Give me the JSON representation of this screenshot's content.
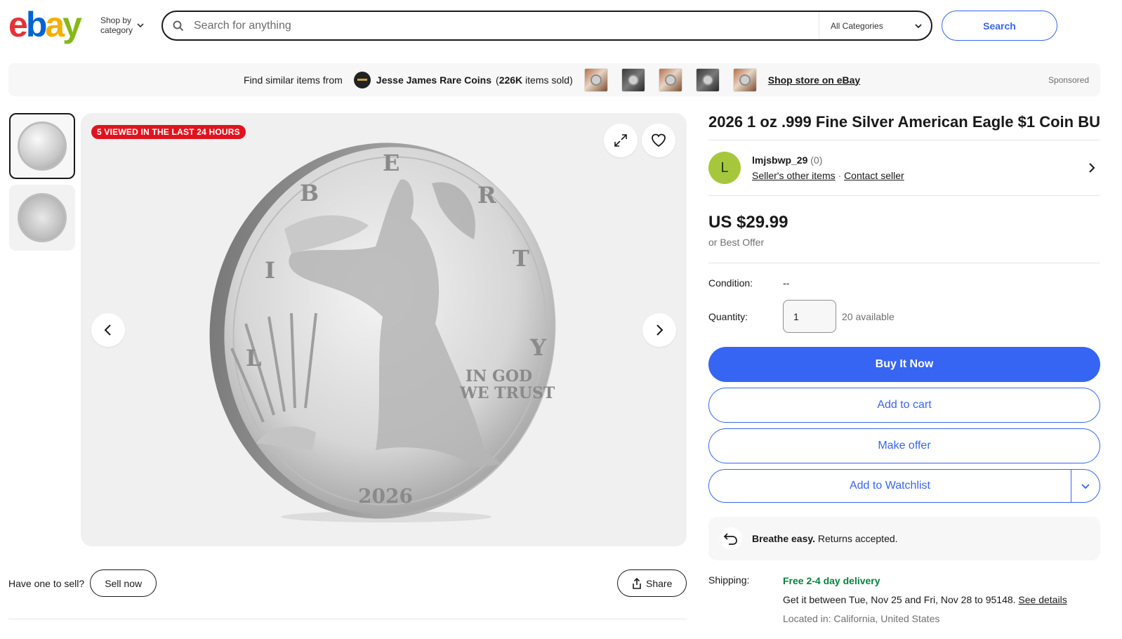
{
  "header": {
    "logo": {
      "e": "e",
      "b": "b",
      "a": "a",
      "y": "y"
    },
    "shop_by_line1": "Shop by",
    "shop_by_line2": "category",
    "search_placeholder": "Search for anything",
    "category_select": "All Categories",
    "search_button": "Search"
  },
  "store_bar": {
    "find_text": "Find similar items from",
    "store_name": "Jesse James Rare Coins",
    "items_sold_open": "(",
    "items_sold_count": "226K",
    "items_sold_rest": " items sold)",
    "shop_link": "Shop store on eBay",
    "sponsored": "Sponsored"
  },
  "gallery": {
    "badge": "5 VIEWED IN THE LAST 24 HOURS",
    "coin_text_year": "2026",
    "coin_text_motto_1": "IN GOD",
    "coin_text_motto_2": "WE TRUST",
    "coin_text_liberty": [
      "L",
      "I",
      "B",
      "E",
      "R",
      "T",
      "Y"
    ]
  },
  "sell": {
    "prompt": "Have one to sell?",
    "sell_button": "Sell now",
    "share_button": "Share"
  },
  "listing": {
    "title": "2026 1 oz .999 Fine Silver American Eagle $1 Coin BU",
    "seller_initial": "L",
    "seller_name": "lmjsbwp_29",
    "seller_feedback": "(0)",
    "seller_other_items": "Seller's other items",
    "contact_seller": "Contact seller",
    "separator": "·",
    "price": "US $29.99",
    "best_offer": "or Best Offer",
    "condition_label": "Condition:",
    "condition_value": "--",
    "quantity_label": "Quantity:",
    "quantity_value": "1",
    "available": "20 available",
    "buy_now": "Buy It Now",
    "add_to_cart": "Add to cart",
    "make_offer": "Make offer",
    "add_to_watchlist": "Add to Watchlist",
    "returns_bold": "Breathe easy.",
    "returns_rest": " Returns accepted.",
    "shipping_label": "Shipping:",
    "shipping_free": "Free 2-4 day delivery",
    "shipping_dates": "Get it between Tue, Nov 25 and Fri, Nov 28 to 95148.",
    "see_details": "See details",
    "located_in": "Located in: California, United States"
  },
  "colors": {
    "accent_blue": "#3665f3",
    "badge_red": "#e0141e",
    "shipping_green": "#05823f",
    "avatar_green": "#a6c73c"
  },
  "icons": [
    "search-icon",
    "chevron-down-icon",
    "expand-icon",
    "heart-icon",
    "chevron-left-icon",
    "chevron-right-icon",
    "share-icon",
    "returns-icon"
  ]
}
